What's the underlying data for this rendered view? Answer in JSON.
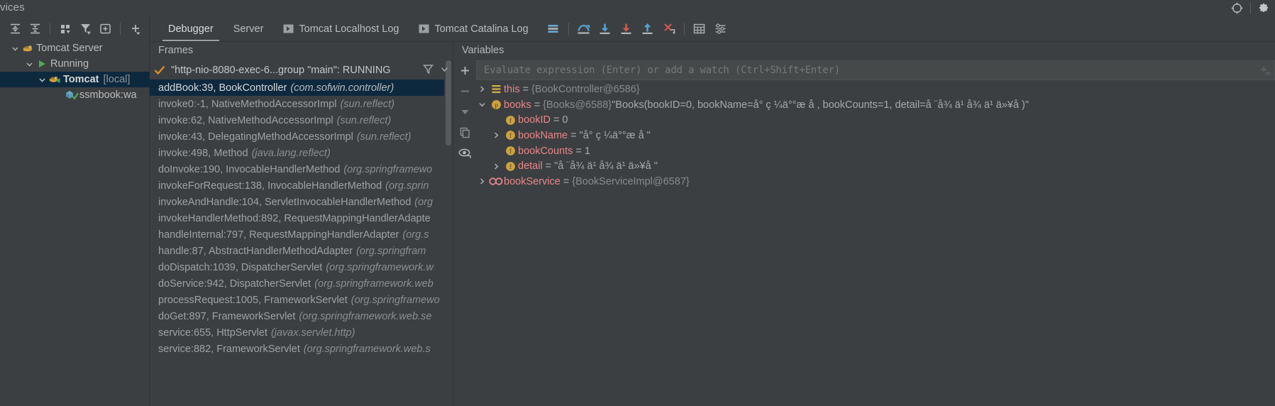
{
  "window": {
    "services_label": "vices",
    "top_icons": [
      "locate-icon",
      "gear-icon"
    ]
  },
  "services_panel": {
    "toolbar": [
      {
        "name": "expand-all-icon",
        "label": "Expand All"
      },
      {
        "name": "collapse-all-icon",
        "label": "Collapse All"
      },
      {
        "name": "group-by-icon",
        "label": "Group By"
      },
      {
        "name": "filter-icon",
        "label": "Filter"
      },
      {
        "name": "add-tab-icon",
        "label": "Add Tab"
      },
      {
        "name": "add-icon",
        "label": "Add"
      }
    ],
    "tree": [
      {
        "label": "Tomcat Server",
        "icon": "tomcat-icon",
        "indent": 0,
        "expanded": true,
        "selected": false,
        "bold": false,
        "sub": ""
      },
      {
        "label": "Running",
        "icon": "run-green-icon",
        "indent": 1,
        "expanded": true,
        "selected": false,
        "bold": false,
        "sub": ""
      },
      {
        "label": "Tomcat",
        "icon": "tomcat-debug-icon",
        "indent": 2,
        "expanded": true,
        "selected": true,
        "bold": true,
        "sub": "[local]"
      },
      {
        "label": "ssmbook:wa",
        "icon": "deployment-icon",
        "indent": 3,
        "expanded": false,
        "selected": false,
        "bold": false,
        "sub": ""
      }
    ]
  },
  "debugger": {
    "tabs": [
      {
        "label": "Debugger",
        "active": true,
        "icon": ""
      },
      {
        "label": "Server",
        "active": false,
        "icon": ""
      },
      {
        "label": "Tomcat Localhost Log",
        "active": false,
        "icon": "console-run-icon"
      },
      {
        "label": "Tomcat Catalina Log",
        "active": false,
        "icon": "console-run-icon"
      }
    ],
    "toolbar": [
      {
        "name": "show-execution-point-icon",
        "label": "Show Execution Point"
      },
      {
        "name": "step-over-icon",
        "label": "Step Over"
      },
      {
        "name": "step-into-icon",
        "label": "Step Into"
      },
      {
        "name": "force-step-into-icon",
        "label": "Force Step Into"
      },
      {
        "name": "step-out-icon",
        "label": "Step Out"
      },
      {
        "name": "drop-frame-icon",
        "label": "Drop Frame"
      },
      {
        "name": "evaluate-expression-icon",
        "label": "Evaluate Expression"
      },
      {
        "name": "settings-lines-icon",
        "label": "Layout Settings"
      }
    ],
    "frames_pane": {
      "title": "Frames",
      "thread": "\"http-nio-8080-exec-6...group \"main\": RUNNING",
      "thread_status_icon": "check-orange-icon",
      "frames": [
        {
          "method": "addBook:39, BookController",
          "pkg": "(com.sofwin.controller)",
          "selected": true
        },
        {
          "method": "invoke0:-1, NativeMethodAccessorImpl",
          "pkg": "(sun.reflect)",
          "selected": false
        },
        {
          "method": "invoke:62, NativeMethodAccessorImpl",
          "pkg": "(sun.reflect)",
          "selected": false
        },
        {
          "method": "invoke:43, DelegatingMethodAccessorImpl",
          "pkg": "(sun.reflect)",
          "selected": false
        },
        {
          "method": "invoke:498, Method",
          "pkg": "(java.lang.reflect)",
          "selected": false
        },
        {
          "method": "doInvoke:190, InvocableHandlerMethod",
          "pkg": "(org.springframewo",
          "selected": false
        },
        {
          "method": "invokeForRequest:138, InvocableHandlerMethod",
          "pkg": "(org.sprin",
          "selected": false
        },
        {
          "method": "invokeAndHandle:104, ServletInvocableHandlerMethod",
          "pkg": "(org",
          "selected": false
        },
        {
          "method": "invokeHandlerMethod:892, RequestMappingHandlerAdapte",
          "pkg": "",
          "selected": false
        },
        {
          "method": "handleInternal:797, RequestMappingHandlerAdapter",
          "pkg": "(org.s",
          "selected": false
        },
        {
          "method": "handle:87, AbstractHandlerMethodAdapter",
          "pkg": "(org.springfram",
          "selected": false
        },
        {
          "method": "doDispatch:1039, DispatcherServlet",
          "pkg": "(org.springframework.w",
          "selected": false
        },
        {
          "method": "doService:942, DispatcherServlet",
          "pkg": "(org.springframework.web",
          "selected": false
        },
        {
          "method": "processRequest:1005, FrameworkServlet",
          "pkg": "(org.springframewo",
          "selected": false
        },
        {
          "method": "doGet:897, FrameworkServlet",
          "pkg": "(org.springframework.web.se",
          "selected": false
        },
        {
          "method": "service:655, HttpServlet",
          "pkg": "(javax.servlet.http)",
          "selected": false
        },
        {
          "method": "service:882, FrameworkServlet",
          "pkg": "(org.springframework.web.s",
          "selected": false
        }
      ]
    },
    "variables_pane": {
      "title": "Variables",
      "eval_placeholder": "Evaluate expression (Enter) or add a watch (Ctrl+Shift+Enter)",
      "gutter_buttons": [
        {
          "name": "add-watch-icon",
          "label": "+"
        },
        {
          "name": "remove-watch-icon",
          "label": "−"
        },
        {
          "name": "move-down-icon",
          "label": "Down"
        },
        {
          "name": "copy-value-icon",
          "label": "Copy"
        },
        {
          "name": "inspect-icon",
          "label": "Inspect"
        }
      ],
      "rows": [
        {
          "indent": 0,
          "arrow": "right",
          "badge": "this-icon",
          "name": "this",
          "eq": "=",
          "ref": "{BookController@6586}",
          "value": ""
        },
        {
          "indent": 0,
          "arrow": "down",
          "badge": "param-icon",
          "name": "books",
          "eq": "=",
          "ref": "{Books@6588}",
          "value": "\"Books(bookID=0, bookName=å°  ç  ¼ä°°æ     å    , bookCounts=1, detail=å  ¨å¾  ä¹  å¾  ä¹  ä»¥å     )\""
        },
        {
          "indent": 1,
          "arrow": "none",
          "badge": "field-icon",
          "name": "bookID",
          "eq": "=",
          "ref": "",
          "value": "0"
        },
        {
          "indent": 1,
          "arrow": "right",
          "badge": "field-icon",
          "name": "bookName",
          "eq": "=",
          "ref": "",
          "value": "\"å°  ç  ¼ä°°æ     å     \""
        },
        {
          "indent": 1,
          "arrow": "none",
          "badge": "field-icon",
          "name": "bookCounts",
          "eq": "=",
          "ref": "",
          "value": "1"
        },
        {
          "indent": 1,
          "arrow": "right",
          "badge": "field-icon",
          "name": "detail",
          "eq": "=",
          "ref": "",
          "value": "\"å  ¨å¾  ä¹  å¾  ä¹  ä»¥å     \""
        },
        {
          "indent": 0,
          "arrow": "right",
          "badge": "service-icon",
          "name": "bookService",
          "eq": "=",
          "ref": "{BookServiceImpl@6587}",
          "value": ""
        }
      ]
    }
  },
  "colors": {
    "background": "#3c3f41",
    "selection": "#0d293e",
    "accent_blue": "#4a90c4",
    "accent_red": "#d0564c",
    "var_name": "#e8868a",
    "gold": "#c9a238",
    "green": "#499c54"
  }
}
